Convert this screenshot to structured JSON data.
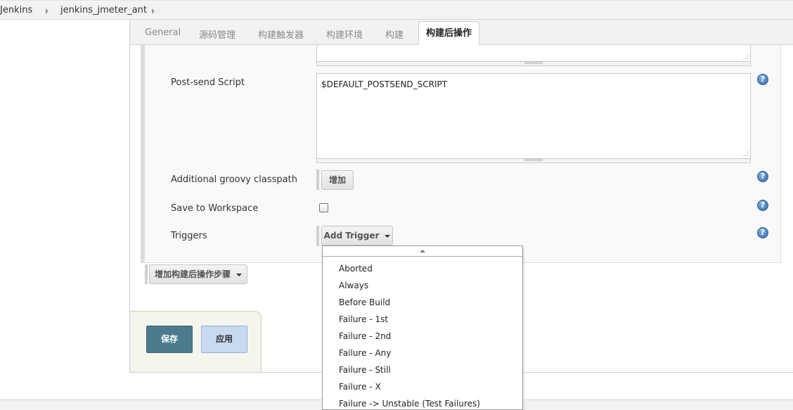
{
  "breadcrumb": {
    "items": [
      "Jenkins",
      "jenkins_jmeter_ant"
    ]
  },
  "tabs": {
    "items": [
      "General",
      "源码管理",
      "构建触发器",
      "构建环境",
      "构建"
    ],
    "active": "构建后操作"
  },
  "form": {
    "post_send_label": "Post-send Script",
    "post_send_value": "$DEFAULT_POSTSEND_SCRIPT",
    "classpath_label": "Additional groovy classpath",
    "classpath_add": "增加",
    "save_workspace_label": "Save to Workspace",
    "save_workspace_checked": false,
    "triggers_label": "Triggers",
    "add_trigger": "Add Trigger",
    "help_glyph": "?"
  },
  "post_build": {
    "add_step": "增加构建后操作步骤"
  },
  "actions": {
    "save": "保存",
    "apply": "应用"
  },
  "trigger_menu": {
    "items": [
      "Aborted",
      "Always",
      "Before Build",
      "Failure - 1st",
      "Failure - 2nd",
      "Failure - Any",
      "Failure - Still",
      "Failure - X",
      "Failure -> Unstable (Test Failures)"
    ]
  },
  "colors": {
    "save_bg": "#4b7b8c",
    "apply_bg": "#c9d9ef",
    "help_blue": "#2c67ad"
  }
}
